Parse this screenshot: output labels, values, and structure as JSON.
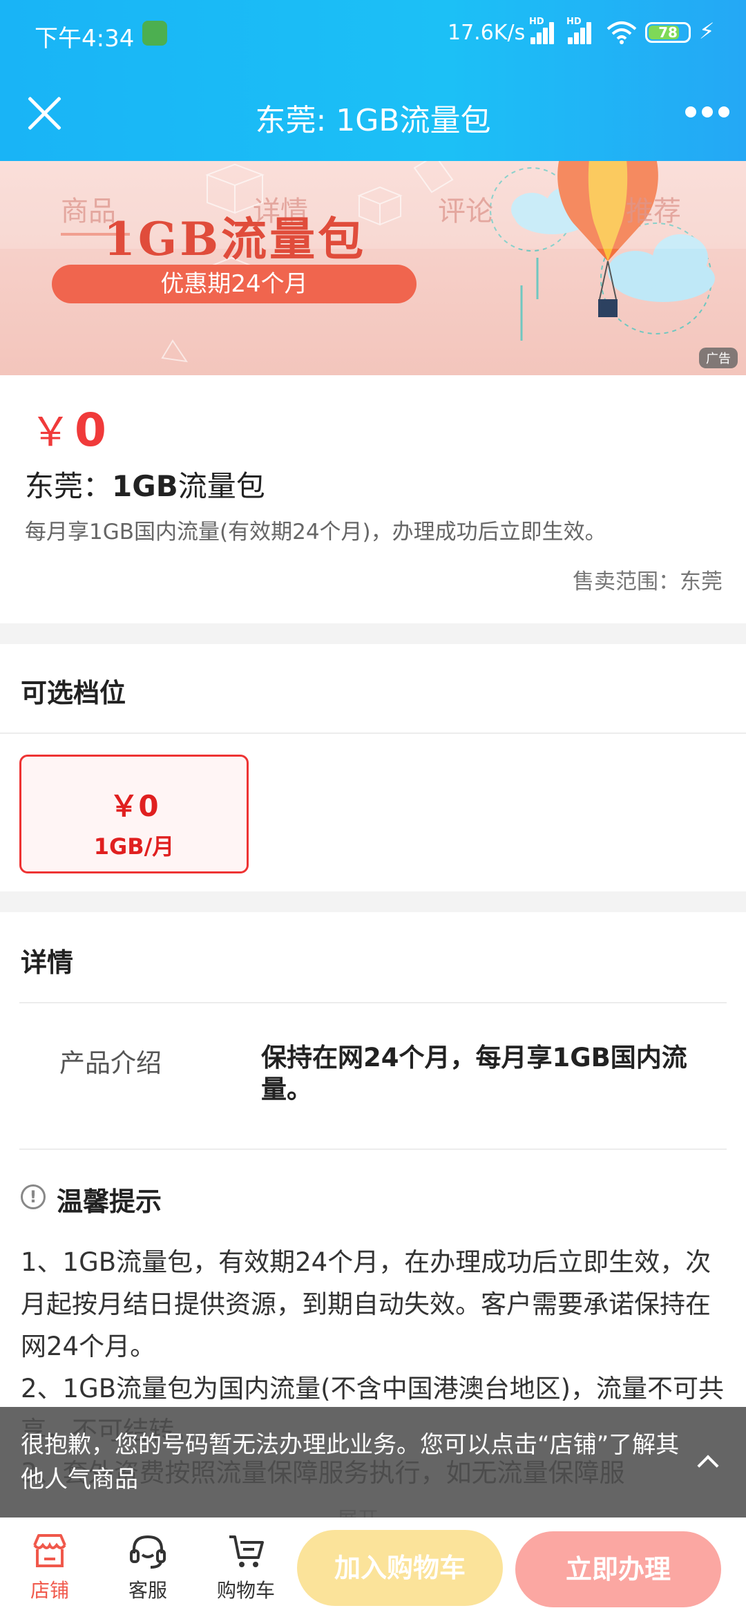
{
  "status_bar": {
    "time": "下午4:34",
    "net_speed": "17.6K/s",
    "hd_badge": "HD",
    "battery": "78",
    "battery_level": 0.78
  },
  "nav": {
    "title": "东莞: 1GB流量包"
  },
  "banner": {
    "tabs": [
      "商品",
      "详情",
      "评论",
      "推荐"
    ],
    "active_tab": "商品",
    "title": "1GB流量包",
    "pill": "优惠期24个月",
    "ad_badge": "广告",
    "colors": {
      "accent": "#f0654e",
      "title": "#e04c3b"
    }
  },
  "product": {
    "price_symbol": "￥",
    "price_value": "0",
    "name_prefix": "东莞：",
    "name_bold": "1GB",
    "name_suffix": "流量包",
    "description": "每月享1GB国内流量(有效期24个月)，办理成功后立即生效。",
    "sale_range": "售卖范围：东莞"
  },
  "tiers": {
    "title": "可选档位",
    "items": [
      {
        "price": "￥0",
        "spec": "1GB/月",
        "selected": true
      }
    ]
  },
  "details": {
    "title": "详情",
    "intro_label": "产品介绍",
    "intro_text": "保持在网24个月，每月享1GB国内流量。"
  },
  "tips": {
    "icon": "!",
    "title": "温馨提示",
    "body": "1、1GB流量包，有效期24个月，在办理成功后立即生效，次月起按月结日提供资源，到期自动失效。客户需要承诺保持在网24个月。\n2、1GB流量包为国内流量(不含中国港澳台地区)，流量不可共享，不可结转。\n3、套外资费按照流量保障服务执行，如无流量保障服",
    "expand": "展开"
  },
  "toast": {
    "message": "很抱歉，您的号码暂无法办理此业务。您可以点击“店铺”了解其他人气商品"
  },
  "bottom_bar": {
    "store": "店铺",
    "service": "客服",
    "cart": "购物车",
    "add_to_cart": "加入购物车",
    "buy_now": "立即办理",
    "colors": {
      "add_to_cart": "#fbe39a",
      "buy_now": "#fba7a2",
      "active": "#f0584b"
    }
  }
}
